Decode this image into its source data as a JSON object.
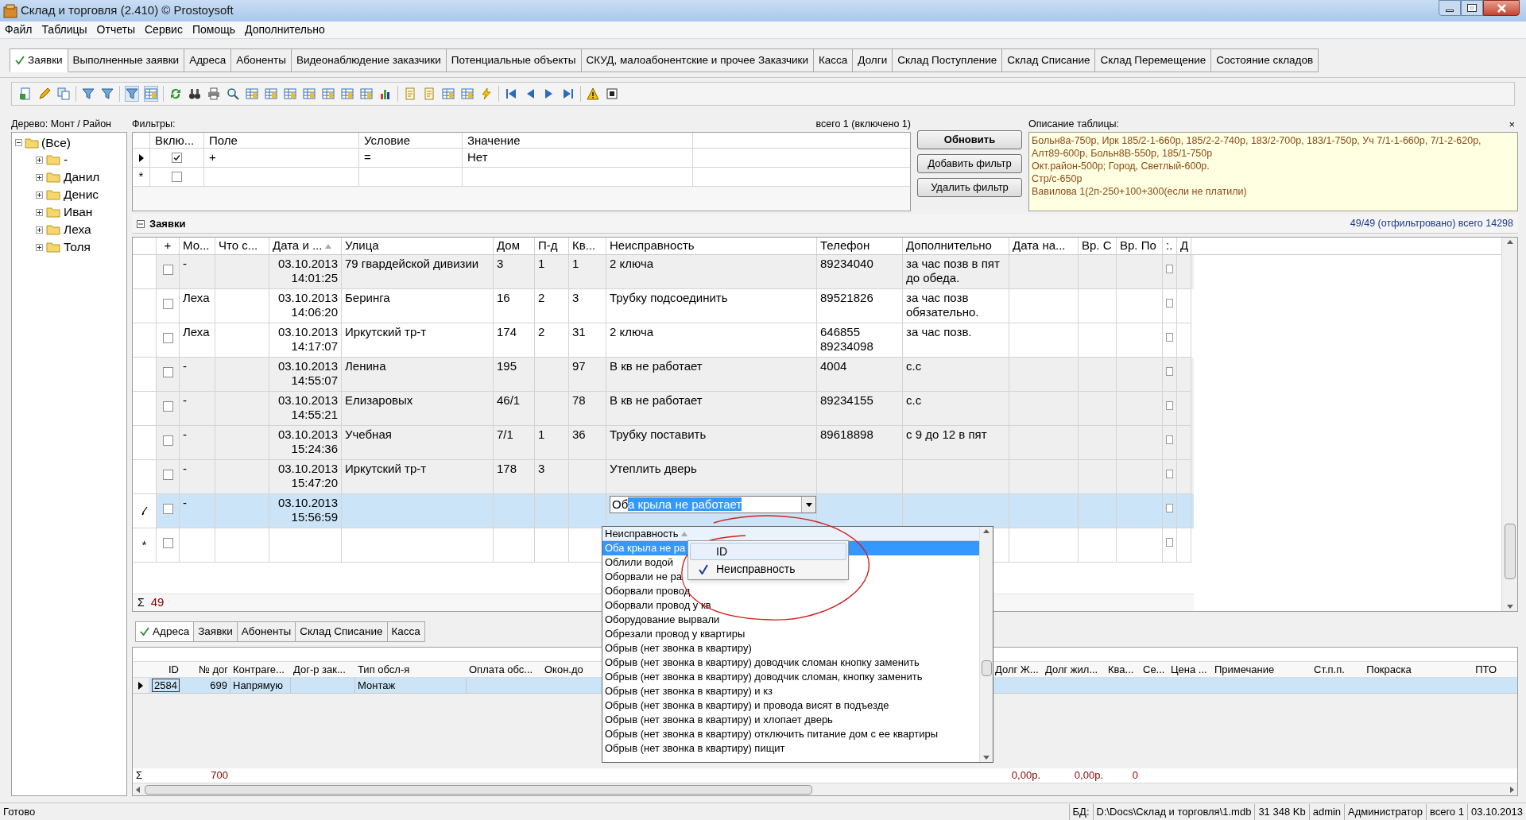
{
  "window": {
    "title": "Склад и торговля (2.410) © Prostoysoft"
  },
  "menu": [
    "Файл",
    "Таблицы",
    "Отчеты",
    "Сервис",
    "Помощь",
    "Дополнительно"
  ],
  "tabs": [
    {
      "label": "Заявки",
      "selected": true
    },
    {
      "label": "Выполненные заявки",
      "selected": false
    },
    {
      "label": "Адреса",
      "selected": false
    },
    {
      "label": "Абоненты",
      "selected": false
    },
    {
      "label": "Видеонаблюдение заказчики",
      "selected": false
    },
    {
      "label": "Потенциальные объекты",
      "selected": false
    },
    {
      "label": "СКУД, малоабонентские и прочее Заказчики",
      "selected": false
    },
    {
      "label": "Касса",
      "selected": false
    },
    {
      "label": "Долги",
      "selected": false
    },
    {
      "label": "Склад Поступление",
      "selected": false
    },
    {
      "label": "Склад Списание",
      "selected": false
    },
    {
      "label": "Склад Перемещение",
      "selected": false
    },
    {
      "label": "Состояние складов",
      "selected": false
    }
  ],
  "tree": {
    "title": "Дерево: Монт / Район",
    "root": {
      "label": "(Все)",
      "expanded": true,
      "children": [
        {
          "label": "-",
          "expanded": false
        },
        {
          "label": "Данил",
          "expanded": false
        },
        {
          "label": "Денис",
          "expanded": false
        },
        {
          "label": "Иван",
          "expanded": false
        },
        {
          "label": "Леха",
          "expanded": false
        },
        {
          "label": "Толя",
          "expanded": false
        }
      ]
    }
  },
  "filters": {
    "title": "Фильтры:",
    "summary": "всего 1 (включено 1)",
    "columns": [
      "Вклю...",
      "Поле",
      "Условие",
      "Значение"
    ],
    "rows": [
      {
        "kind": "current",
        "enabled": true,
        "field": "+",
        "condition": "=",
        "value": "Нет"
      },
      {
        "kind": "new",
        "marker": "*",
        "enabled": false
      }
    ],
    "buttons": [
      {
        "label": "Обновить",
        "primary": true
      },
      {
        "label": "Добавить фильтр",
        "primary": false
      },
      {
        "label": "Удалить фильтр",
        "primary": false
      }
    ]
  },
  "table_description": {
    "title": "Описание таблицы:",
    "close": "×",
    "lines": [
      "Больн8а-750р, Ирк 185/2-1-660р, 185/2-2-740р, 183/2-700р, 183/1-750р, Уч 7/1-1-660р, 7/1-2-620р,",
      "Алт89-600р, Больн8В-550р, 185/1-750р",
      "Окт.район-500р; Город, Светлый-600р.",
      "Стр/с-650р",
      "Вавилова 1(2п-250+100+300(если не платили)"
    ]
  },
  "orders": {
    "title": "Заявки",
    "expanded": true,
    "count": "49/49 (отфильтровано) всего 14298",
    "columns": [
      {
        "label": "+"
      },
      {
        "label": "Мо..."
      },
      {
        "label": "Что с..."
      },
      {
        "label": "Дата и ...",
        "sorted": true
      },
      {
        "label": "Улица"
      },
      {
        "label": "Дом"
      },
      {
        "label": "П-д"
      },
      {
        "label": "Кв..."
      },
      {
        "label": "Неисправность"
      },
      {
        "label": "Телефон"
      },
      {
        "label": "Дополнительно"
      },
      {
        "label": "Дата на..."
      },
      {
        "label": "Вр. С"
      },
      {
        "label": "Вр. По"
      },
      {
        "label": ":."
      },
      {
        "label": "Д"
      }
    ],
    "rows": [
      {
        "kind": "data",
        "shaded": true,
        "checked": false,
        "master": "-",
        "date": "03.10.2013",
        "time": "14:01:25",
        "street": "79 гвардейской дивизии",
        "house": "3",
        "entrance": "1",
        "apartment": "1",
        "fault": "2 ключа",
        "phone": "89234040",
        "extra": "за час позв в пят до обеда.",
        "flag": false
      },
      {
        "kind": "data",
        "shaded": false,
        "checked": false,
        "master": "Леха",
        "date": "03.10.2013",
        "time": "14:06:20",
        "street": "Беринга",
        "house": "16",
        "entrance": "2",
        "apartment": "3",
        "fault": "Трубку подсоединить",
        "phone": "89521826",
        "extra": "за час позв обязательно.",
        "flag": false
      },
      {
        "kind": "data",
        "shaded": false,
        "checked": false,
        "master": "Леха",
        "date": "03.10.2013",
        "time": "14:17:07",
        "street": "Иркутский тр-т",
        "house": "174",
        "entrance": "2",
        "apartment": "31",
        "fault": "2 ключа",
        "phone": "646855 89234098",
        "extra": "за час позв.",
        "flag": false
      },
      {
        "kind": "data",
        "shaded": true,
        "checked": false,
        "master": "-",
        "date": "03.10.2013",
        "time": "14:55:07",
        "street": "Ленина",
        "house": "195",
        "apartment": "97",
        "fault": "В кв не работает",
        "phone": "4004",
        "extra": "с.с",
        "flag": false
      },
      {
        "kind": "data",
        "shaded": true,
        "checked": false,
        "master": "-",
        "date": "03.10.2013",
        "time": "14:55:21",
        "street": "Елизаровых",
        "house": "46/1",
        "apartment": "78",
        "fault": "В кв не работает",
        "phone": "89234155",
        "extra": "с.с",
        "flag": false
      },
      {
        "kind": "data",
        "shaded": true,
        "checked": false,
        "master": "-",
        "date": "03.10.2013",
        "time": "15:24:36",
        "street": "Учебная",
        "house": "7/1",
        "entrance": "1",
        "apartment": "36",
        "fault": "Трубку поставить",
        "phone": "89618898",
        "extra": "с 9 до 12 в пят",
        "flag": false
      },
      {
        "kind": "data",
        "shaded": true,
        "checked": false,
        "master": "-",
        "date": "03.10.2013",
        "time": "15:47:20",
        "street": "Иркутский тр-т",
        "house": "178",
        "entrance": "3",
        "fault": "Утеплить дверь",
        "flag": false
      },
      {
        "kind": "editing",
        "checked": false,
        "master": "-",
        "date": "03.10.2013",
        "time": "15:56:59",
        "fault_typed": "Об",
        "fault_selected": "а крыла не работает",
        "flag": false
      },
      {
        "kind": "new",
        "marker": "*",
        "shaded": false,
        "checked": false,
        "flag": false
      }
    ],
    "sum_symbol": "Σ",
    "sum": "49"
  },
  "fault_dropdown": {
    "header": "Неисправность",
    "sorted": true,
    "items": [
      {
        "label": "Оба крыла не ра",
        "selected": true
      },
      {
        "label": "Облили водой",
        "selected": false
      },
      {
        "label": "Оборвали не ра",
        "selected": false
      },
      {
        "label": "Оборвали провод",
        "selected": false
      },
      {
        "label": "Оборвали провод у кв",
        "selected": false
      },
      {
        "label": "Оборудование вырвали",
        "selected": false
      },
      {
        "label": "Обрезали провод у квартиры",
        "selected": false
      },
      {
        "label": "Обрыв (нет звонка в квартиру)",
        "selected": false
      },
      {
        "label": "Обрыв (нет звонка в квартиру) доводчик сломан кнопку заменить",
        "selected": false
      },
      {
        "label": "Обрыв (нет звонка в квартиру) доводчик сломан, кнопку заменить",
        "selected": false
      },
      {
        "label": "Обрыв (нет звонка в квартиру) и кз",
        "selected": false
      },
      {
        "label": "Обрыв (нет звонка в квартиру) и провода висят в подъезде",
        "selected": false
      },
      {
        "label": "Обрыв (нет звонка в квартиру) и хлопает дверь",
        "selected": false
      },
      {
        "label": "Обрыв (нет звонка в квартиру) отключить питание дом с ее квартиры",
        "selected": false
      },
      {
        "label": "Обрыв (нет звонка в квартиру) пищит",
        "selected": false
      }
    ]
  },
  "column_menu": [
    {
      "label": "ID",
      "checked": false,
      "highlighted": true
    },
    {
      "label": "Неисправность",
      "checked": true,
      "highlighted": false
    }
  ],
  "bottom_tabs": [
    {
      "label": "Адреса",
      "selected": true
    },
    {
      "label": "Заявки",
      "selected": false
    },
    {
      "label": "Абоненты",
      "selected": false
    },
    {
      "label": "Склад Списание",
      "selected": false
    },
    {
      "label": "Касса",
      "selected": false
    }
  ],
  "addresses": {
    "columns_left": [
      "ID",
      "№ дог",
      "Контраге...",
      "Дог-р зак...",
      "Тип обсл-я",
      "Оплата обс...",
      "Окон.до"
    ],
    "columns_right": [
      "Долг Ж...",
      "Долг жил...",
      "Ква...",
      "Се...",
      "Цена ...",
      "Примечание",
      "Ст.п.п.",
      "Покраска",
      "ПТО"
    ],
    "row": {
      "selected": true,
      "id": "2584",
      "contract_no": "699",
      "counterparty": "Напрямую",
      "service_type": "Монтаж"
    },
    "sum_symbol": "Σ",
    "sum_contract_no": "700",
    "sum_debt": "0,00р.",
    "sum_housing_debt": "0,00р.",
    "sum_apartments": "0"
  },
  "status_bar": {
    "state": "Готово",
    "db_label": "БД:",
    "db_path": "D:\\Docs\\Склад и торговля\\1.mdb",
    "size": "31 348 Kb",
    "user": "admin",
    "role": "Администратор",
    "total": "всего 1",
    "date": "03.10.2013"
  }
}
